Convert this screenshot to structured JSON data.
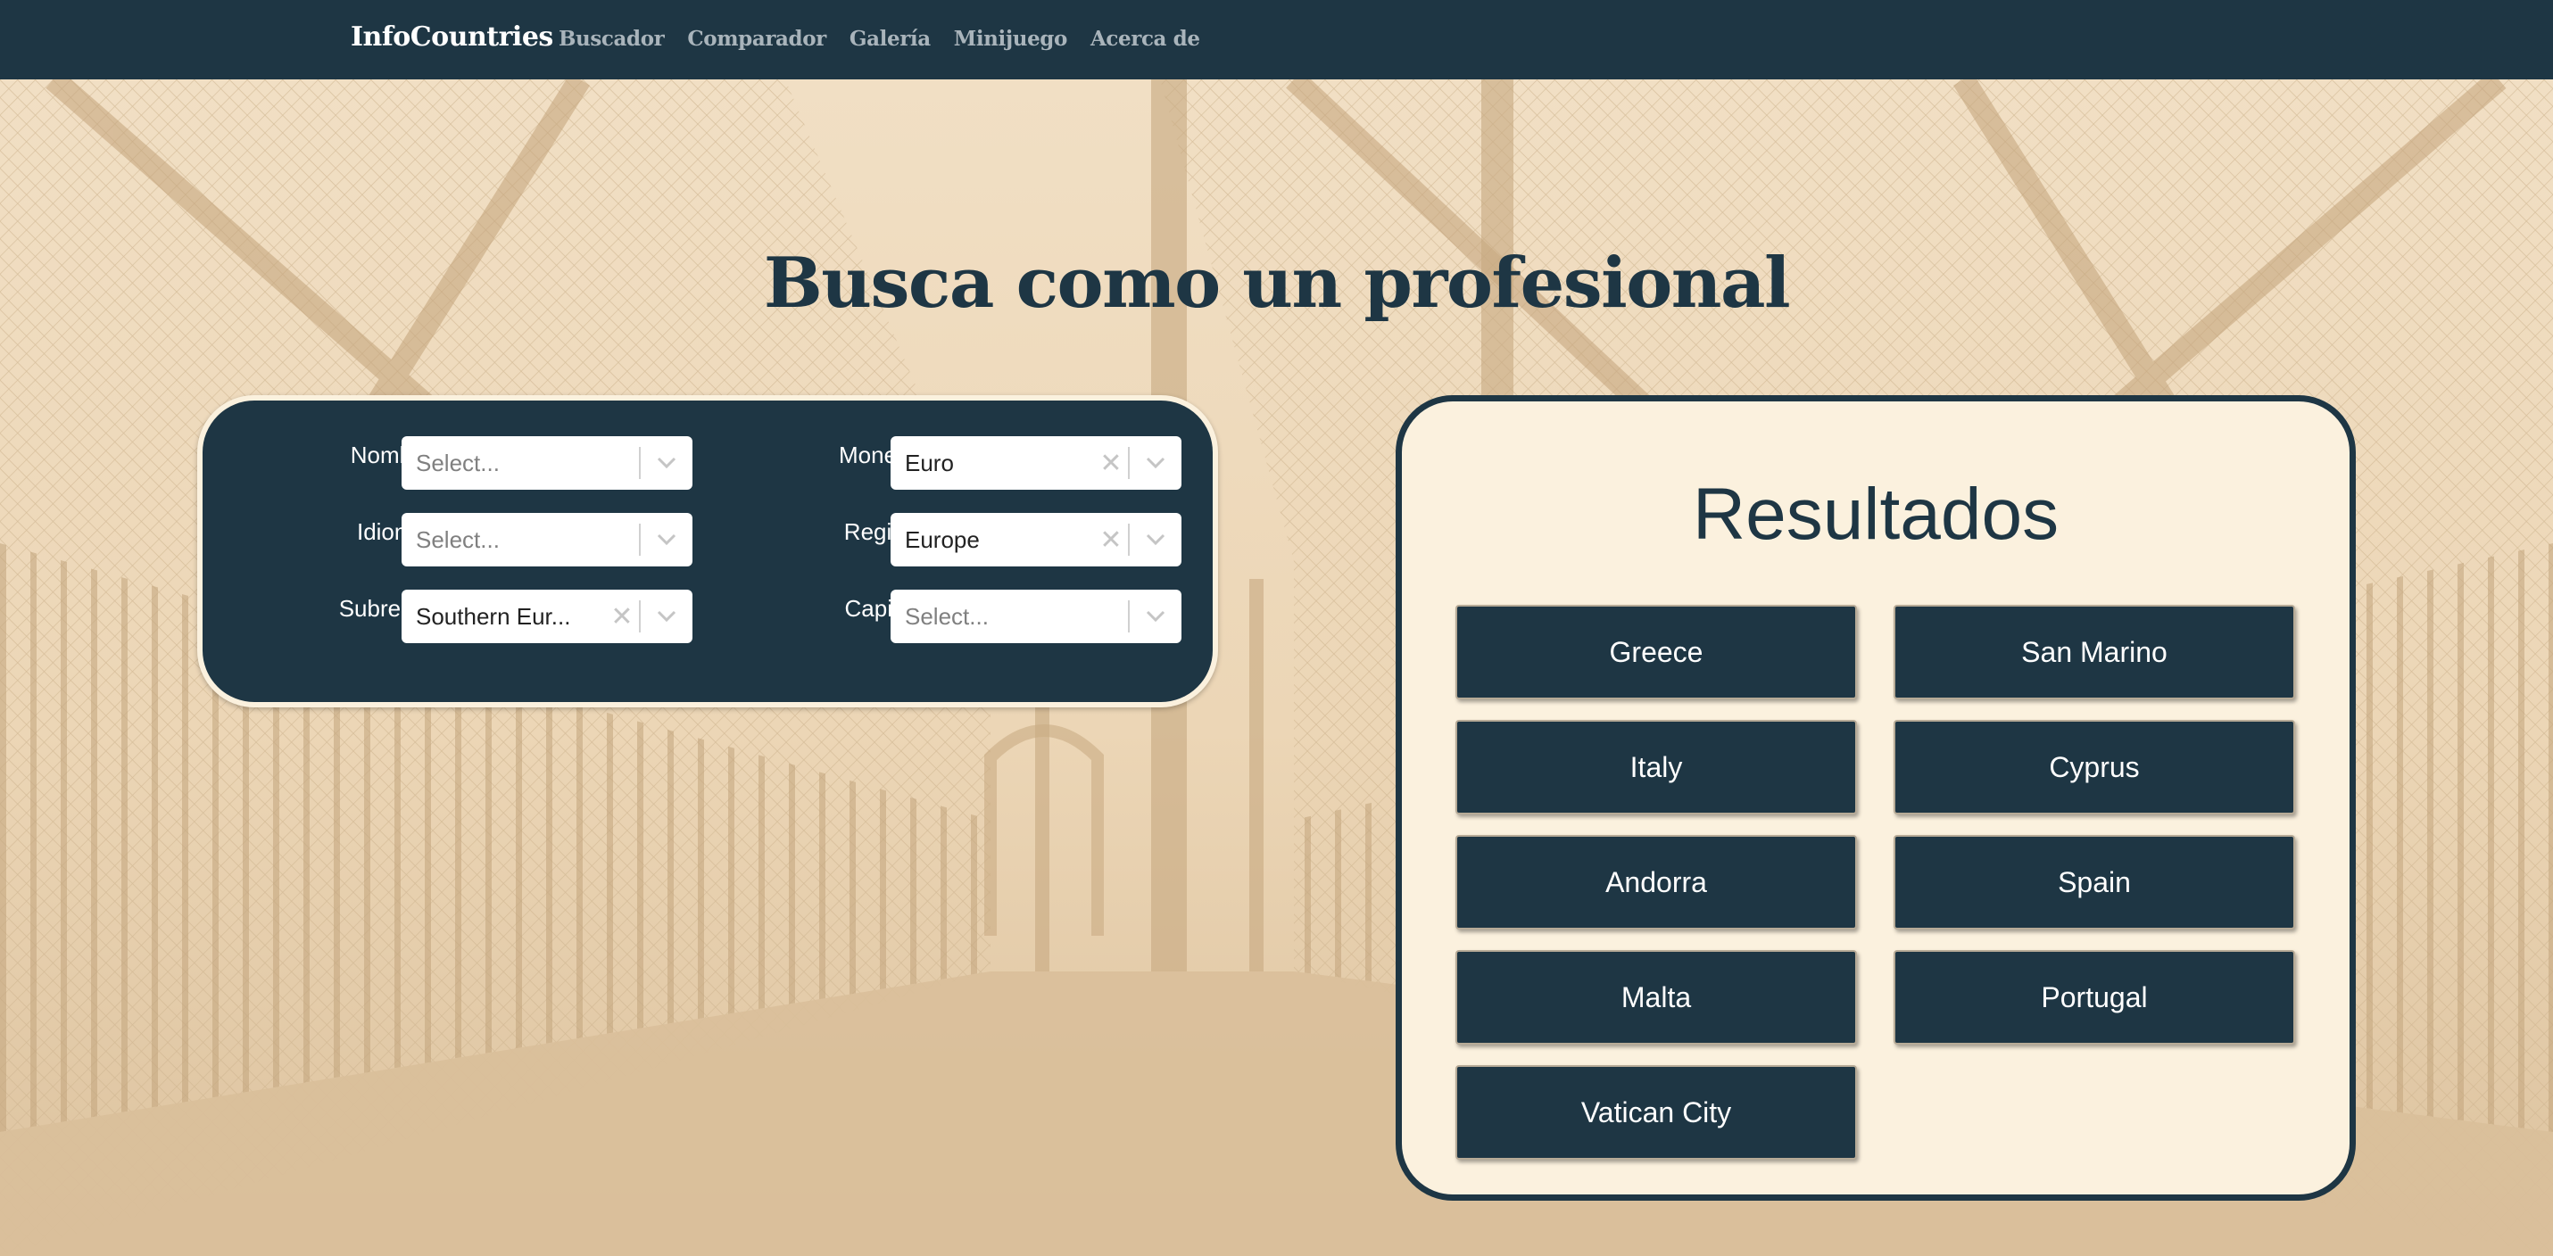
{
  "navbar": {
    "brand": "InfoCountries",
    "links": [
      "Buscador",
      "Comparador",
      "Galería",
      "Minijuego",
      "Acerca de"
    ]
  },
  "hero": {
    "title": "Busca como un profesional"
  },
  "filters": {
    "name": {
      "label": "Nombre",
      "value": "",
      "placeholder": "Select..."
    },
    "language": {
      "label": "Idioma",
      "value": "",
      "placeholder": "Select..."
    },
    "subregion": {
      "label": "Subregión",
      "value": "Southern Eur...",
      "placeholder": ""
    },
    "currency": {
      "label": "Moneda",
      "value": "Euro",
      "placeholder": ""
    },
    "region": {
      "label": "Región",
      "value": "Europe",
      "placeholder": ""
    },
    "capital": {
      "label": "Capital",
      "value": "",
      "placeholder": "Select..."
    }
  },
  "results": {
    "title": "Resultados",
    "countries": [
      "Greece",
      "San Marino",
      "Italy",
      "Cyprus",
      "Andorra",
      "Spain",
      "Malta",
      "Portugal",
      "Vatican City"
    ]
  },
  "colors": {
    "navy": "#1e3644",
    "cream": "#fbf1de",
    "sepia_background": "#e9d3b3"
  },
  "icons": {
    "clear": "close-icon",
    "dropdown": "chevron-down-icon"
  }
}
